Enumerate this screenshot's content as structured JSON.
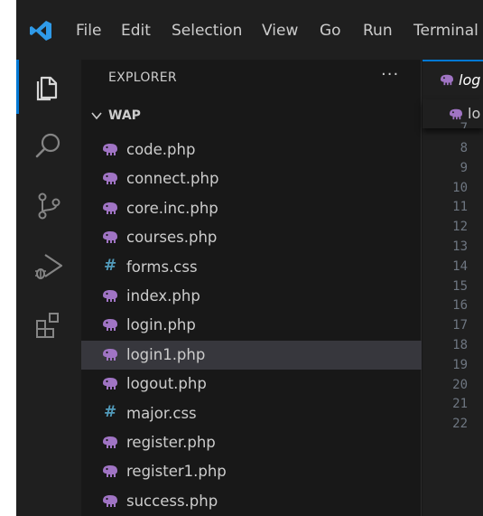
{
  "menu": [
    "File",
    "Edit",
    "Selection",
    "View",
    "Go",
    "Run",
    "Terminal"
  ],
  "activity_bar": [
    "explorer-icon",
    "search-icon",
    "source-control-icon",
    "run-debug-icon",
    "extensions-icon"
  ],
  "sidebar": {
    "title": "EXPLORER",
    "more": "···",
    "folder": "WAP",
    "files": [
      {
        "name": "code.php",
        "icon": "php-elephant-icon"
      },
      {
        "name": "connect.php",
        "icon": "php-elephant-icon"
      },
      {
        "name": "core.inc.php",
        "icon": "php-elephant-icon"
      },
      {
        "name": "courses.php",
        "icon": "php-elephant-icon"
      },
      {
        "name": "forms.css",
        "icon": "css-hash-icon"
      },
      {
        "name": "index.php",
        "icon": "php-elephant-icon"
      },
      {
        "name": "login.php",
        "icon": "php-elephant-icon"
      },
      {
        "name": "login1.php",
        "icon": "php-elephant-icon",
        "selected": true
      },
      {
        "name": "logout.php",
        "icon": "php-elephant-icon"
      },
      {
        "name": "major.css",
        "icon": "css-hash-icon"
      },
      {
        "name": "register.php",
        "icon": "php-elephant-icon"
      },
      {
        "name": "register1.php",
        "icon": "php-elephant-icon"
      },
      {
        "name": "success.php",
        "icon": "php-elephant-icon"
      }
    ]
  },
  "editor": {
    "tab_label": "log",
    "breadcrumb_label": "lo",
    "line_numbers": [
      "7",
      "8",
      "9",
      "10",
      "11",
      "12",
      "13",
      "14",
      "15",
      "16",
      "17",
      "18",
      "19",
      "20",
      "21",
      "22"
    ]
  },
  "colors": {
    "php_icon": "#a074c4",
    "css_icon": "#519aba",
    "accent": "#0078d4",
    "selection_bg": "#37373d"
  }
}
